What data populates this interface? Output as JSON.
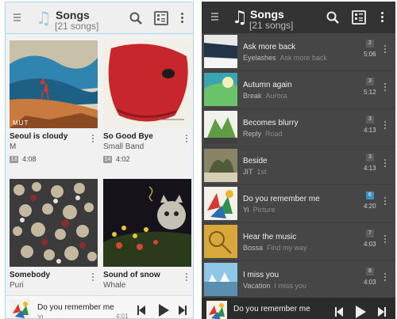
{
  "colors": {
    "accent": "#a9d7ee",
    "dark_bg": "#464646",
    "dark_header": "#333333",
    "active_badge": "#3a8fc3"
  },
  "light_panel": {
    "header": {
      "title": "Songs",
      "subtitle": "[21 songs]",
      "icons": [
        "menu-icon",
        "music-note-icon",
        "search-icon",
        "view-toggle-icon",
        "more-icon"
      ]
    },
    "grid": [
      {
        "title": "Seoul is cloudy",
        "artist": "M",
        "track": "13",
        "duration": "4:08"
      },
      {
        "title": "So Good Bye",
        "artist": "Small Band",
        "track": "14",
        "duration": "4:02"
      },
      {
        "title": "Somebody",
        "artist": "Puri"
      },
      {
        "title": "Sound of snow",
        "artist": "Whale"
      }
    ],
    "art_text": {
      "album1_mark": "MUT"
    },
    "mini_player": {
      "title": "Do you remember me",
      "subtitle": "Yi",
      "time": "4:01"
    }
  },
  "dark_panel": {
    "header": {
      "title": "Songs",
      "subtitle": "[21 songs]",
      "icons": [
        "menu-icon",
        "music-note-icon",
        "search-icon",
        "view-toggle-icon",
        "more-icon"
      ]
    },
    "list": [
      {
        "title": "Ask more back",
        "artist": "Eyelashes",
        "album": "Ask more back",
        "track": "2",
        "duration": "5:06"
      },
      {
        "title": "Autumn again",
        "artist": "Break",
        "album": "Aurora",
        "track": "3",
        "duration": "5:12"
      },
      {
        "title": "Becomes blurry",
        "artist": "Reply",
        "album": "Road",
        "track": "3",
        "duration": "4:13"
      },
      {
        "title": "Beside",
        "artist": "JIT",
        "album": "1st",
        "track": "3",
        "duration": "4:13"
      },
      {
        "title": "Do you remember me",
        "artist": "Yi",
        "album": "Picture",
        "track": "6",
        "duration": "4:20",
        "active": true
      },
      {
        "title": "Hear the music",
        "artist": "Bossa",
        "album": "Find my way",
        "track": "7",
        "duration": "4:03"
      },
      {
        "title": "I miss you",
        "artist": "Vacation",
        "album": "I miss you",
        "track": "8",
        "duration": "4:03"
      }
    ],
    "mini_player": {
      "title": "Do you remember me"
    }
  }
}
